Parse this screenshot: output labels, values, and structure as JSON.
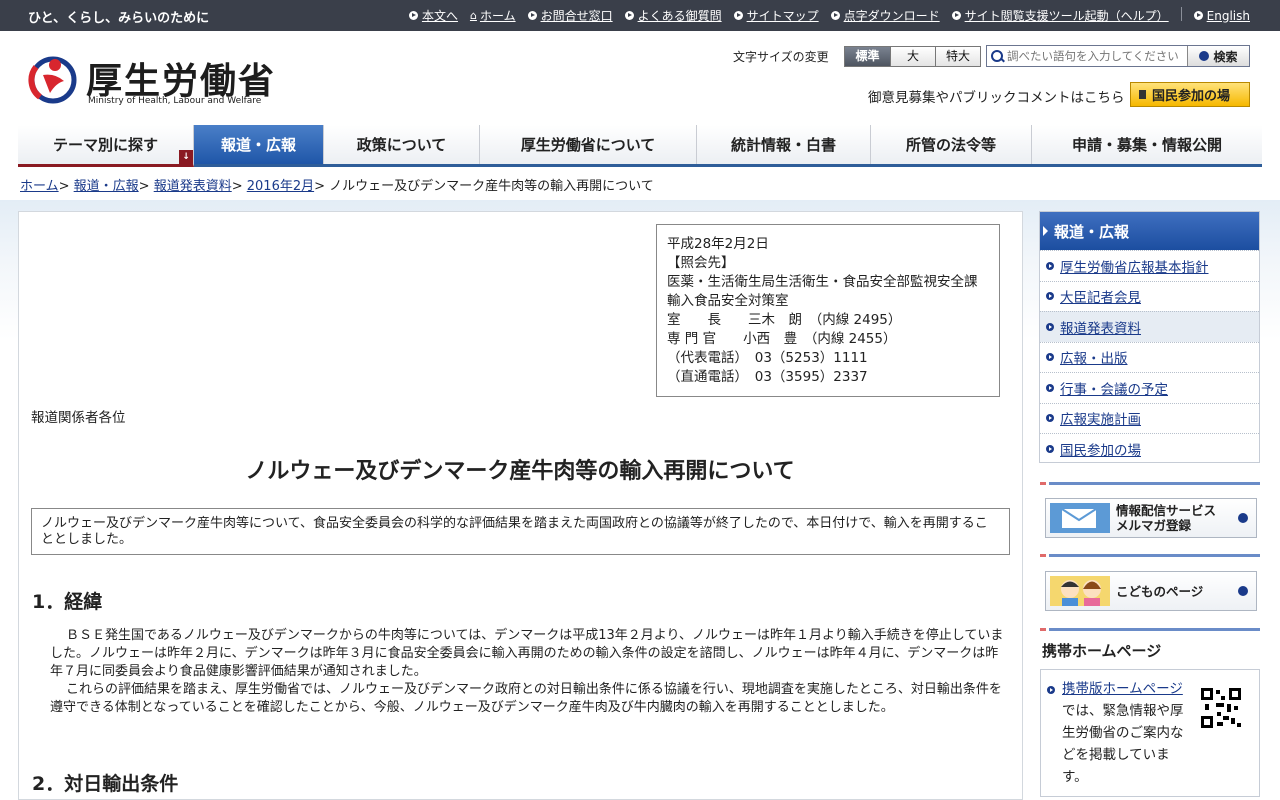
{
  "topbar": {
    "tagline": "ひと、くらし、みらいのために",
    "links": [
      "本文へ",
      "ホーム",
      "お問合せ窓口",
      "よくある御質問",
      "サイトマップ",
      "点字ダウンロード",
      "サイト閲覧支援ツール起動（ヘルプ）",
      "English"
    ]
  },
  "header": {
    "logo_text": "厚生労働省",
    "logo_sub": "Ministry of Health, Labour and Welfare",
    "fontsize_label": "文字サイズの変更",
    "fontsize_options": [
      "標準",
      "大",
      "特大"
    ],
    "search_placeholder": "調べたい語句を入力してください",
    "search_button": "検索",
    "opinion_text": "御意見募集やパブリックコメントはこちら",
    "kokumin_button": "国民参加の場"
  },
  "nav": {
    "items": [
      "テーマ別に探す",
      "報道・広報",
      "政策について",
      "厚生労働省について",
      "統計情報・白書",
      "所管の法令等",
      "申請・募集・情報公開"
    ]
  },
  "breadcrumb": {
    "links": [
      "ホーム",
      "報道・広報",
      "報道発表資料",
      "2016年2月"
    ],
    "current": "ノルウェー及びデンマーク産牛肉等の輸入再開について"
  },
  "contact": {
    "date": "平成28年2月2日",
    "heading": "【照会先】",
    "dept": "医薬・生活衛生局生活衛生・食品安全部監視安全課",
    "office": "輸入食品安全対策室",
    "person1": "室　　長　　三木　朗　（内線 2495）",
    "person2": "専 門 官　　小西　豊　（内線 2455）",
    "phone1": "（代表電話）　03（5253）1111",
    "phone2": "（直通電話）　03（3595）2337"
  },
  "article": {
    "to_press": "報道関係者各位",
    "title": "ノルウェー及びデンマーク産牛肉等の輸入再開について",
    "summary": "ノルウェー及びデンマーク産牛肉等について、食品安全委員会の科学的な評価結果を踏まえた両国政府との協議等が終了したので、本日付けで、輸入を再開することとしました。",
    "section1_heading": "1．経緯",
    "section1_p1": "ＢＳＥ発生国であるノルウェー及びデンマークからの牛肉等については、デンマークは平成13年２月より、ノルウェーは昨年１月より輸入手続きを停止していました。ノルウェーは昨年２月に、デンマークは昨年３月に食品安全委員会に輸入再開のための輸入条件の設定を諮問し、ノルウェーは昨年４月に、デンマークは昨年７月に同委員会より食品健康影響評価結果が通知されました。",
    "section1_p2": "これらの評価結果を踏まえ、厚生労働省では、ノルウェー及びデンマーク政府との対日輸出条件に係る協議を行い、現地調査を実施したところ、対日輸出条件を遵守できる体制となっていることを確認したことから、今般、ノルウェー及びデンマーク産牛肉及び牛内臓肉の輸入を再開することとしました。",
    "section2_heading": "2．対日輸出条件"
  },
  "sidebar": {
    "heading": "報道・広報",
    "items": [
      "厚生労働省広報基本指針",
      "大臣記者会見",
      "報道発表資料",
      "広報・出版",
      "行事・会議の予定",
      "広報実施計画",
      "国民参加の場"
    ],
    "current_index": 2,
    "banner1_line1": "情報配信サービス",
    "banner1_line2": "メルマガ登録",
    "banner2": "こどものページ",
    "mobile_title": "携帯ホームページ",
    "mobile_link": "携帯版ホームページ",
    "mobile_text": "では、緊急情報や厚生労働省のご案内などを掲載しています。"
  },
  "colors": {
    "topbar": "#3a3f4a",
    "nav_active": "#1f56a8",
    "link": "#1a3a8a",
    "accent_button": "#f6b800"
  }
}
